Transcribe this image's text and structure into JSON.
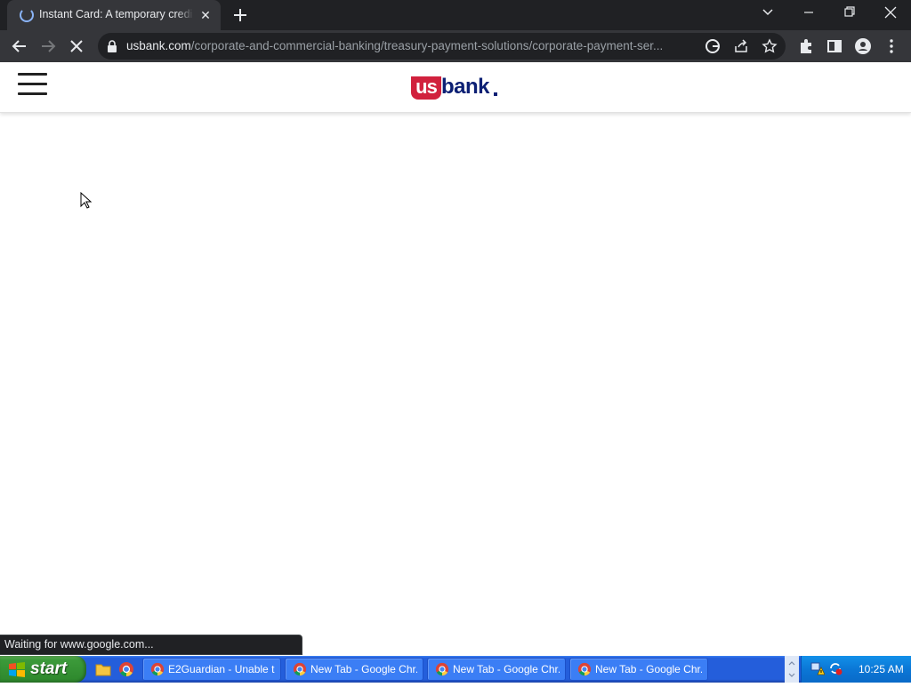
{
  "browser": {
    "tab": {
      "title": "Instant Card: A temporary credit card"
    },
    "address_bar": {
      "url_host": "usbank.com",
      "url_path": "/corporate-and-commercial-banking/treasury-payment-solutions/corporate-payment-ser..."
    },
    "status_bubble": "Waiting for www.google.com..."
  },
  "page": {
    "logo": {
      "us": "us",
      "bank": "bank"
    }
  },
  "taskbar": {
    "start_label": "start",
    "windows": [
      {
        "label": "E2Guardian - Unable t..."
      },
      {
        "label": "New Tab - Google Chr..."
      },
      {
        "label": "New Tab - Google Chr..."
      },
      {
        "label": "New Tab - Google Chr..."
      }
    ],
    "clock": "10:25 AM"
  },
  "colors": {
    "usbank_red": "#d1213d",
    "usbank_navy": "#0c2074",
    "chrome_dark": "#202124",
    "xp_blue": "#245edb",
    "xp_green": "#3c9a3a"
  }
}
